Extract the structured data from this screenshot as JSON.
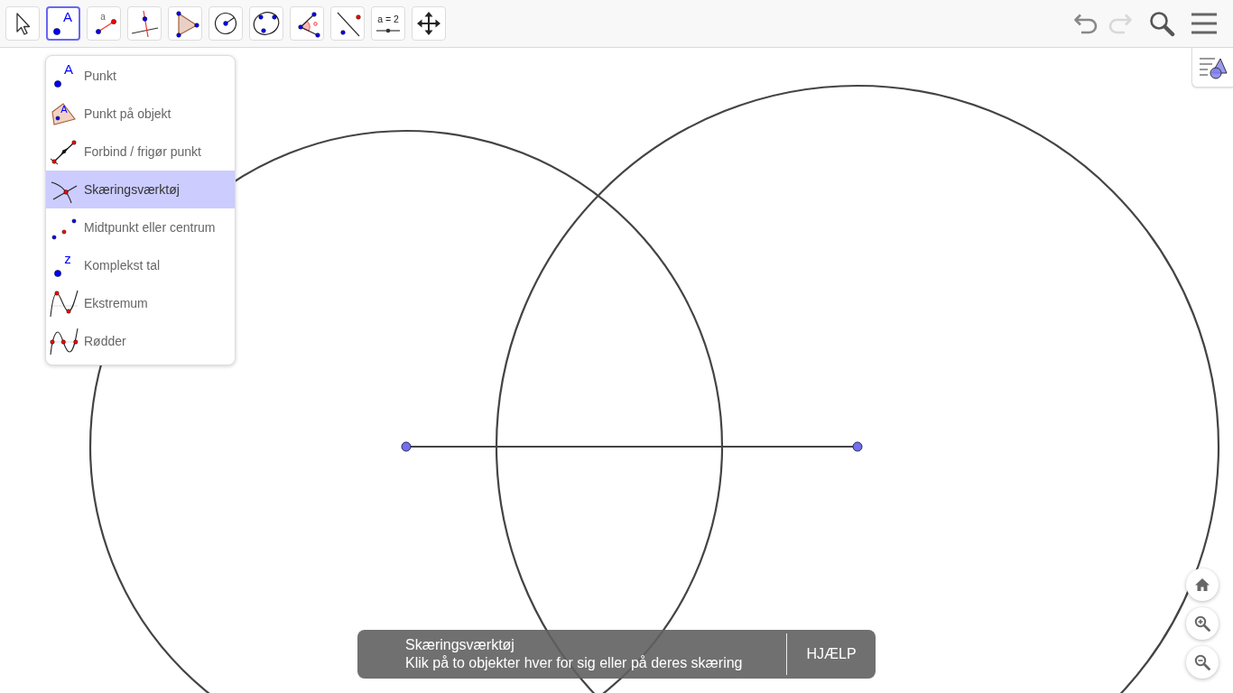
{
  "toolbar": {
    "tools": [
      {
        "kind": "move",
        "selected": false
      },
      {
        "kind": "point",
        "glyph": "A",
        "selected": true
      },
      {
        "kind": "segment",
        "glyph": "a",
        "selected": false
      },
      {
        "kind": "perpendicular",
        "selected": false
      },
      {
        "kind": "polygon",
        "selected": false
      },
      {
        "kind": "circle",
        "selected": false
      },
      {
        "kind": "conic",
        "selected": false
      },
      {
        "kind": "angle",
        "selected": false
      },
      {
        "kind": "reflect",
        "selected": false
      },
      {
        "kind": "slider",
        "glyph": "a = 2",
        "selected": false
      },
      {
        "kind": "move-view",
        "selected": false
      }
    ],
    "undo": {
      "disabled": false
    },
    "redo": {
      "disabled": true
    }
  },
  "tool_menu": {
    "items": [
      {
        "kind": "point",
        "glyph": "A",
        "label": "Punkt",
        "selected": false
      },
      {
        "kind": "point-on-object",
        "glyph": "A",
        "label": "Punkt på objekt",
        "selected": false
      },
      {
        "kind": "attach-detach",
        "label": "Forbind / frigør punkt",
        "selected": false
      },
      {
        "kind": "intersect",
        "label": "Skæringsværktøj",
        "selected": true
      },
      {
        "kind": "midpoint",
        "label": "Midtpunkt eller centrum",
        "selected": false
      },
      {
        "kind": "complex",
        "glyph": "z",
        "label": "Komplekst tal",
        "selected": false
      },
      {
        "kind": "extremum",
        "label": "Ekstremum",
        "selected": false
      },
      {
        "kind": "roots",
        "label": "Rødder",
        "selected": false
      }
    ]
  },
  "graphics": {
    "objects": [
      {
        "kind": "circle"
      },
      {
        "kind": "circle"
      },
      {
        "kind": "segment"
      },
      {
        "kind": "point"
      },
      {
        "kind": "point"
      }
    ]
  },
  "tooltip": {
    "title": "Skæringsværktøj",
    "description": "Klik på to objekter hver for sig eller på deres skæring",
    "button": "HJÆLP"
  }
}
